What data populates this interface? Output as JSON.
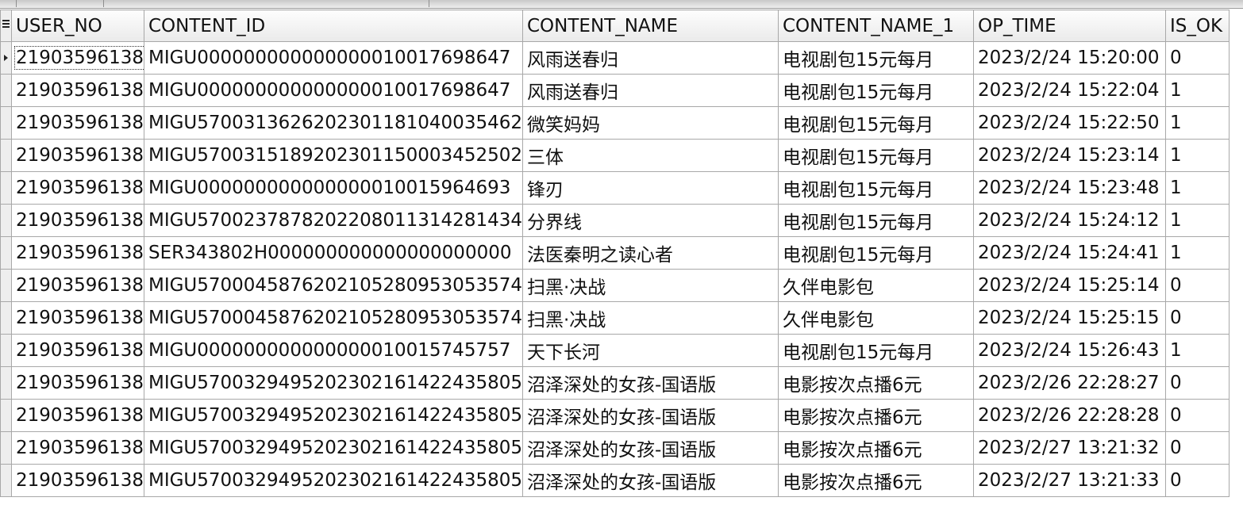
{
  "grid": {
    "columns": [
      "USER_NO",
      "CONTENT_ID",
      "CONTENT_NAME",
      "CONTENT_NAME_1",
      "OP_TIME",
      "IS_OK"
    ],
    "rows": [
      [
        "21903596138",
        "MIGU000000000000000010017698647",
        "风雨送春归",
        "电视剧包15元每月",
        "2023/2/24 15:20:00",
        "0"
      ],
      [
        "21903596138",
        "MIGU000000000000000010017698647",
        "风雨送春归",
        "电视剧包15元每月",
        "2023/2/24 15:22:04",
        "1"
      ],
      [
        "21903596138",
        "MIGU570031362620230118104003546​2",
        "微笑妈妈",
        "电视剧包15元每月",
        "2023/2/24 15:22:50",
        "1"
      ],
      [
        "21903596138",
        "MIGU570031518920230115000345250​2",
        "三体",
        "电视剧包15元每月",
        "2023/2/24 15:23:14",
        "1"
      ],
      [
        "21903596138",
        "MIGU000000000000000010015964693",
        "锋刃",
        "电视剧包15元每月",
        "2023/2/24 15:23:48",
        "1"
      ],
      [
        "21903596138",
        "MIGU570023787820220801131428143​4",
        "分界线",
        "电视剧包15元每月",
        "2023/2/24 15:24:12",
        "1"
      ],
      [
        "21903596138",
        "SER343802H000000000000000000000",
        "法医秦明之读心者",
        "电视剧包15元每月",
        "2023/2/24 15:24:41",
        "1"
      ],
      [
        "21903596138",
        "MIGU570004587620210528095305357​4",
        "扫黑·决战",
        "久伴电影包",
        "2023/2/24 15:25:14",
        "0"
      ],
      [
        "21903596138",
        "MIGU570004587620210528095305357​4",
        "扫黑·决战",
        "久伴电影包",
        "2023/2/24 15:25:15",
        "0"
      ],
      [
        "21903596138",
        "MIGU000000000000000010015745757",
        "天下长河",
        "电视剧包15元每月",
        "2023/2/24 15:26:43",
        "1"
      ],
      [
        "21903596138",
        "MIGU570032949520230216142243580​5",
        "沼泽深处的女孩-国语版",
        "电影按次点播6元",
        "2023/2/26 22:28:27",
        "0"
      ],
      [
        "21903596138",
        "MIGU570032949520230216142243580​5",
        "沼泽深处的女孩-国语版",
        "电影按次点播6元",
        "2023/2/26 22:28:28",
        "0"
      ],
      [
        "21903596138",
        "MIGU570032949520230216142243580​5",
        "沼泽深处的女孩-国语版",
        "电影按次点播6元",
        "2023/2/27 13:21:32",
        "0"
      ],
      [
        "21903596138",
        "MIGU570032949520230216142243580​5",
        "沼泽深处的女孩-国语版",
        "电影按次点播6元",
        "2023/2/27 13:21:33",
        "0"
      ]
    ]
  }
}
